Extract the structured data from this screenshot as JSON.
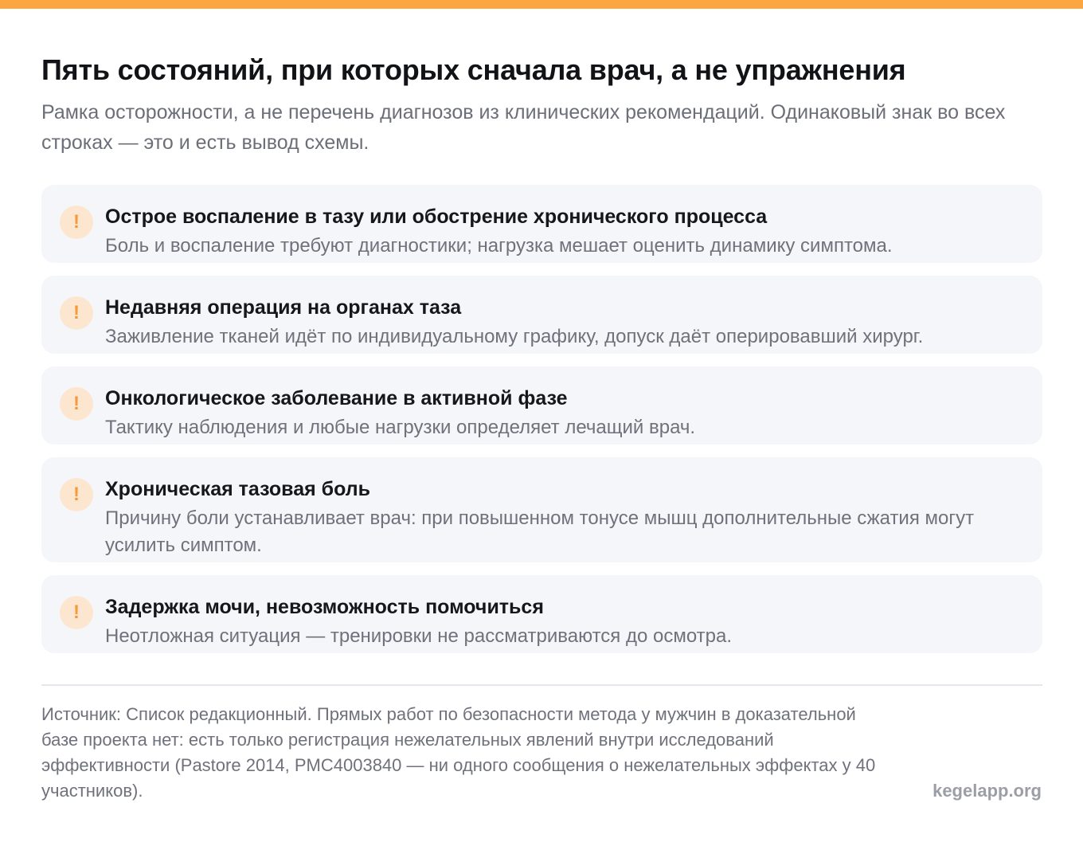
{
  "colors": {
    "accent": "#fca641",
    "warning_icon": "#f59a3a",
    "warning_icon_bg": "#fde6cf",
    "card_bg": "#f5f6fa",
    "muted_text": "#6f717b"
  },
  "header": {
    "title": "Пять состояний, при которых сначала врач, а не упражнения",
    "subtitle": "Рамка осторожности, а не перечень диагнозов из клинических рекомендаций. Одинаковый знак во всех строках — это и есть вывод схемы."
  },
  "items": [
    {
      "icon": "exclamation-icon",
      "symbol": "!",
      "title": "Острое воспаление в тазу или обострение хронического процесса",
      "description": "Боль и воспаление требуют диагностики; нагрузка мешает оценить динамику симптома."
    },
    {
      "icon": "exclamation-icon",
      "symbol": "!",
      "title": "Недавняя операция на органах таза",
      "description": "Заживление тканей идёт по индивидуальному графику, допуск даёт оперировавший хирург."
    },
    {
      "icon": "exclamation-icon",
      "symbol": "!",
      "title": "Онкологическое заболевание в активной фазе",
      "description": "Тактику наблюдения и любые нагрузки определяет лечащий врач."
    },
    {
      "icon": "exclamation-icon",
      "symbol": "!",
      "title": "Хроническая тазовая боль",
      "description": "Причину боли устанавливает врач: при повышенном тонусе мышц дополнительные сжатия могут усилить симптом."
    },
    {
      "icon": "exclamation-icon",
      "symbol": "!",
      "title": "Задержка мочи, невозможность помочиться",
      "description": "Неотложная ситуация — тренировки не рассматриваются до осмотра."
    }
  ],
  "footer": {
    "source": "Источник: Список редакционный. Прямых работ по безопасности метода у мужчин в доказательной базе проекта нет: есть только регистрация нежелательных явлений внутри исследований эффективности (Pastore 2014, PMC4003840 — ни одного сообщения о нежелательных эффектах у 40 участников).",
    "brand": "kegelapp.org"
  }
}
